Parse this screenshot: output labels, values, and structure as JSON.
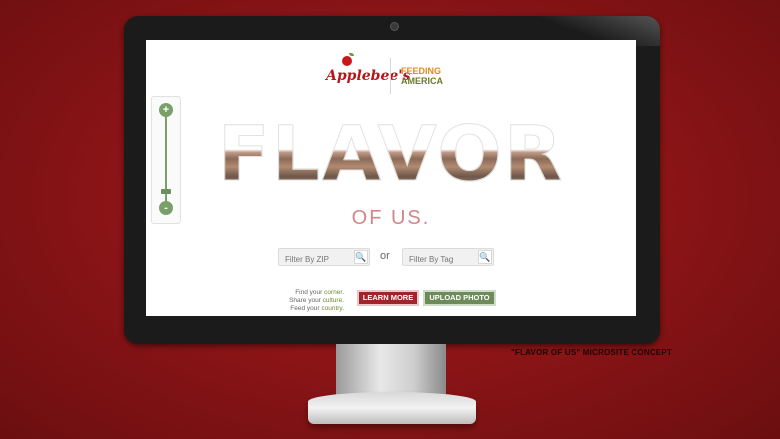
{
  "brand": {
    "applebees": "Applebee's",
    "feeding_line1": "FEEDING",
    "feeding_line2": "AMERICA"
  },
  "hero": {
    "title": "FLAVOR",
    "subtitle": "OF US."
  },
  "zoom": {
    "plus": "+",
    "minus": "-"
  },
  "filters": {
    "zip_placeholder": "Filter By ZIP",
    "tag_placeholder": "Filter By Tag",
    "or_label": "or",
    "search_glyph": "🔍"
  },
  "tagline": {
    "line1_pre": "Find your ",
    "line1_key": "corner",
    "line1_post": ".",
    "line2_pre": "Share your ",
    "line2_key": "culture",
    "line2_post": ".",
    "line3_pre": "Feed your ",
    "line3_key": "country",
    "line3_post": "."
  },
  "buttons": {
    "learn_more": "LEARN MORE",
    "upload_photo": "UPLOAD PHOTO"
  },
  "caption": "\"FLAVOR OF US\" MICROSITE CONCEPT",
  "colors": {
    "background": "#8e1517",
    "brand_red": "#a0242a",
    "green": "#6c8a5a"
  }
}
